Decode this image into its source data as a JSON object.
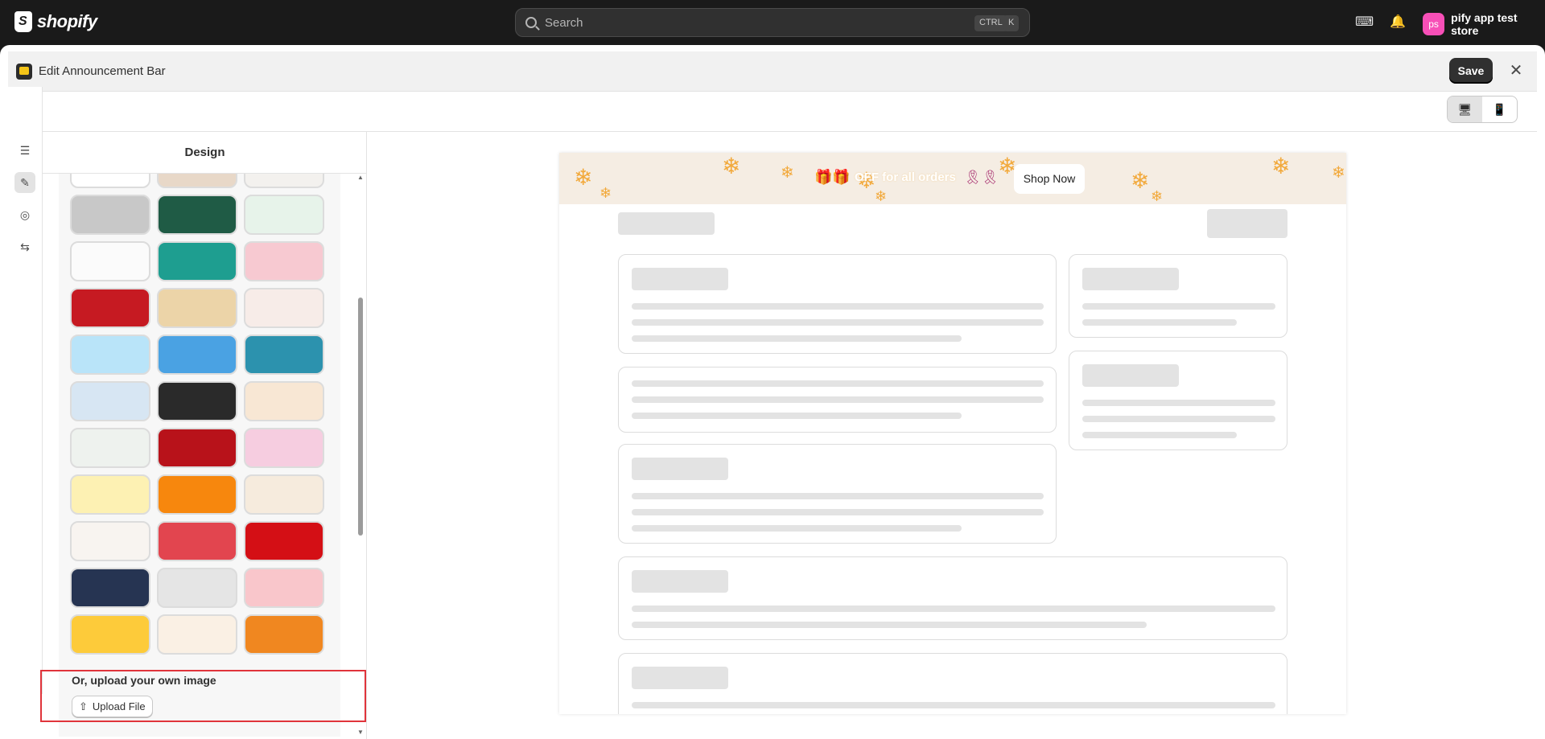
{
  "topbar": {
    "brand": "shopify",
    "search_placeholder": "Search",
    "kbd1": "CTRL",
    "kbd2": "K",
    "avatar_initials": "ps",
    "store_name": "pify app test store"
  },
  "editor": {
    "title": "Edit Announcement Bar",
    "save_label": "Save"
  },
  "panel": {
    "title": "Design",
    "upload_title": "Or, upload your own image",
    "upload_button": "Upload File"
  },
  "rail_icons": [
    "content-icon",
    "design-icon",
    "targeting-icon",
    "settings-icon"
  ],
  "tiles": [
    {
      "name": "snow-red-stars",
      "color": "#ffffff"
    },
    {
      "name": "beige-flowers",
      "color": "#e8d8c8"
    },
    {
      "name": "diamond-pattern",
      "color": "#f3f1ee"
    },
    {
      "name": "gray-plaid",
      "color": "#c8c8c8"
    },
    {
      "name": "green-stripes",
      "color": "#1f5b45"
    },
    {
      "name": "light-green-pattern",
      "color": "#e7f3ea"
    },
    {
      "name": "white-stars",
      "color": "#fbfbfb"
    },
    {
      "name": "teal-ornament",
      "color": "#1e9e90"
    },
    {
      "name": "pink-dots",
      "color": "#f7c9d1"
    },
    {
      "name": "red-lanterns",
      "color": "#c61a22"
    },
    {
      "name": "tan-pattern",
      "color": "#ecd4a8"
    },
    {
      "name": "pastel-dots",
      "color": "#f7ece8"
    },
    {
      "name": "light-blue",
      "color": "#b9e4f9"
    },
    {
      "name": "blue-pattern",
      "color": "#4aa2e3"
    },
    {
      "name": "teal-reindeer",
      "color": "#2c92ae"
    },
    {
      "name": "blue-gingham",
      "color": "#d7e6f3"
    },
    {
      "name": "black-stars",
      "color": "#2a2a2a"
    },
    {
      "name": "cream-clouds",
      "color": "#f8e7d4"
    },
    {
      "name": "white-snow-hills",
      "color": "#eef2ee"
    },
    {
      "name": "red-mistletoe",
      "color": "#b8121a"
    },
    {
      "name": "pink-gingham",
      "color": "#f6cde0"
    },
    {
      "name": "yellow-hearts",
      "color": "#fdf1b3"
    },
    {
      "name": "orange-pumpkins",
      "color": "#f7870d"
    },
    {
      "name": "cream-chevron",
      "color": "#f6ebdd"
    },
    {
      "name": "confetti",
      "color": "#f8f4f0"
    },
    {
      "name": "red-gifts",
      "color": "#e2454f"
    },
    {
      "name": "red-texture",
      "color": "#d40f15"
    },
    {
      "name": "navy-gold",
      "color": "#263452"
    },
    {
      "name": "gray-waves",
      "color": "#e5e5e5"
    },
    {
      "name": "pink-diamonds",
      "color": "#f9c6cb"
    },
    {
      "name": "yellow-solid",
      "color": "#fdcb3a"
    },
    {
      "name": "cream-flowers",
      "color": "#faf0e4"
    },
    {
      "name": "orange-plaid",
      "color": "#f08720"
    }
  ],
  "announcement": {
    "text": "OFF for all orders",
    "button_label": "Shop Now",
    "text_color": "#ffffff"
  },
  "colors": {
    "accent_outline": "#e0343b",
    "dark": "#303030",
    "avatar": "#f74fb7"
  }
}
